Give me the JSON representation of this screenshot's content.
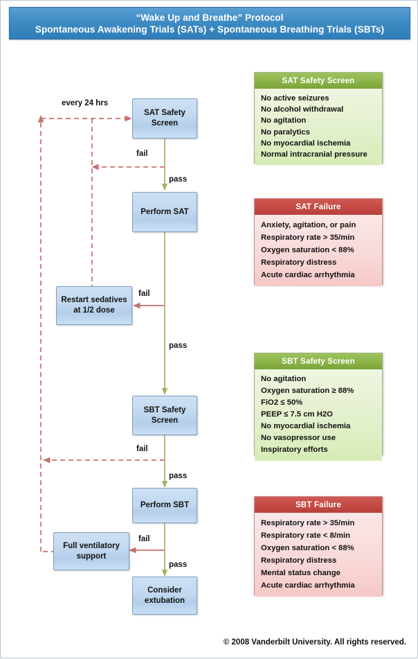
{
  "title": {
    "line1": "“Wake Up and Breathe” Protocol",
    "line2": "Spontaneous Awakening Trials (SATs) + Spontaneous Breathing Trials (SBTs)"
  },
  "colors": {
    "banner_blue": "#3f8cc4",
    "box_blue": "#c3d9f0",
    "green_header": "#8cb348",
    "green_body": "#e2f0cc",
    "red_header": "#c44a44",
    "red_body": "#f8d9d8",
    "pass_arrow": "#9bb35b",
    "fail_arrow": "#c4706a",
    "dashed_arrow": "#c4706a"
  },
  "flow": {
    "nodes": [
      {
        "id": "sat-safety-screen",
        "label": "SAT Safety\nScreen"
      },
      {
        "id": "perform-sat",
        "label": "Perform SAT"
      },
      {
        "id": "restart-sedatives",
        "label": "Restart sedatives\nat 1/2 dose"
      },
      {
        "id": "sbt-safety-screen",
        "label": "SBT Safety\nScreen"
      },
      {
        "id": "perform-sbt",
        "label": "Perform SBT"
      },
      {
        "id": "full-vent-support",
        "label": "Full ventilatory\nsupport"
      },
      {
        "id": "consider-extubation",
        "label": "Consider\nextubation"
      }
    ],
    "edge_labels": {
      "every_24_hrs": "every 24 hrs",
      "sat_screen_fail": "fail",
      "sat_screen_pass": "pass",
      "perform_sat_fail": "fail",
      "perform_sat_pass": "pass",
      "sbt_screen_fail": "fail",
      "sbt_screen_pass": "pass",
      "perform_sbt_fail": "fail",
      "perform_sbt_pass": "pass"
    }
  },
  "panels": [
    {
      "id": "sat-safety-screen-panel",
      "variant": "green",
      "title": "SAT Safety Screen",
      "items": [
        "No active seizures",
        "No alcohol withdrawal",
        "No agitation",
        "No paralytics",
        "No myocardial ischemia",
        "Normal intracranial pressure"
      ]
    },
    {
      "id": "sat-failure-panel",
      "variant": "red",
      "title": "SAT Failure",
      "items": [
        "Anxiety, agitation, or pain",
        "Respiratory rate > 35/min",
        "Oxygen saturation < 88%",
        "Respiratory distress",
        "Acute cardiac arrhythmia"
      ]
    },
    {
      "id": "sbt-safety-screen-panel",
      "variant": "green",
      "title": "SBT Safety Screen",
      "items": [
        "No agitation",
        "Oxygen saturation ≥ 88%",
        "FiO2 ≤ 50%",
        "PEEP ≤ 7.5 cm H2O",
        "No myocardial ischemia",
        "No vasopressor use",
        "Inspiratory efforts"
      ]
    },
    {
      "id": "sbt-failure-panel",
      "variant": "red",
      "title": "SBT Failure",
      "items": [
        "Respiratory rate > 35/min",
        "Respiratory rate < 8/min",
        "Oxygen saturation < 88%",
        "Respiratory distress",
        "Mental status change",
        "Acute cardiac arrhythmia"
      ]
    }
  ],
  "footer": "© 2008 Vanderbilt University. All rights reserved."
}
